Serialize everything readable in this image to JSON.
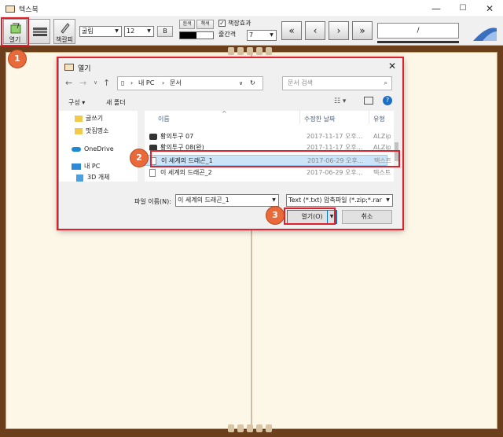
{
  "window": {
    "title": "텍스북",
    "minimize": "—",
    "maximize": "☐",
    "close": "✕"
  },
  "toolbar": {
    "open_label": "열기",
    "bookshelf_label": "",
    "bookmark_label": "책갈피",
    "font_name": "굴림",
    "font_size": "12",
    "bold_label": "B",
    "white_label": "흰색",
    "black_label": "책색",
    "page_effect_label": "책장효과",
    "page_effect_checked": true,
    "line_spacing_label": "줄간격",
    "line_spacing_value": "7",
    "page_indicator": "/",
    "nav_first": "«",
    "nav_prev": "‹",
    "nav_next": "›",
    "nav_last": "»"
  },
  "dialog": {
    "title": "열기",
    "close": "✕",
    "breadcrumb": [
      "내 PC",
      "문서"
    ],
    "search_placeholder": "문서 검색",
    "organize_label": "구성 ▾",
    "new_folder_label": "새 폴더",
    "sidebar": [
      {
        "label": "글쓰기",
        "icon": "folder-icon"
      },
      {
        "label": "맛집명소",
        "icon": "folder-icon"
      },
      {
        "label": "OneDrive",
        "icon": "cloud-icon"
      },
      {
        "label": "내 PC",
        "icon": "pc-icon"
      },
      {
        "label": "3D 개체",
        "icon": "cube-icon"
      }
    ],
    "columns": {
      "name": "이름",
      "date": "수정한 날짜",
      "type": "유형"
    },
    "files": [
      {
        "name": "황의투구 07",
        "date": "2017-11-17 오후...",
        "type": "ALZip",
        "icon": "zip-icon"
      },
      {
        "name": "황의투구 08(완)",
        "date": "2017-11-17 오후...",
        "type": "ALZip",
        "icon": "zip-icon"
      },
      {
        "name": "이 세계의 드래곤_1",
        "date": "2017-06-29 오후...",
        "type": "텍스트",
        "icon": "text-file-icon",
        "selected": true
      },
      {
        "name": "이 세계의 드래곤_2",
        "date": "2017-06-29 오후...",
        "type": "텍스트",
        "icon": "text-file-icon"
      }
    ],
    "filename_label": "파일 이름(N):",
    "filename_value": "이 세계의 드래곤_1",
    "filetype_value": "Text (*.txt) 압축파일 (*.zip;*.rar",
    "open_button": "열기(O)",
    "cancel_button": "취소"
  },
  "annotations": {
    "step1": "1",
    "step2": "2",
    "step3": "3",
    "highlight_color": "#e0202a",
    "badge_color": "#e8693a"
  }
}
